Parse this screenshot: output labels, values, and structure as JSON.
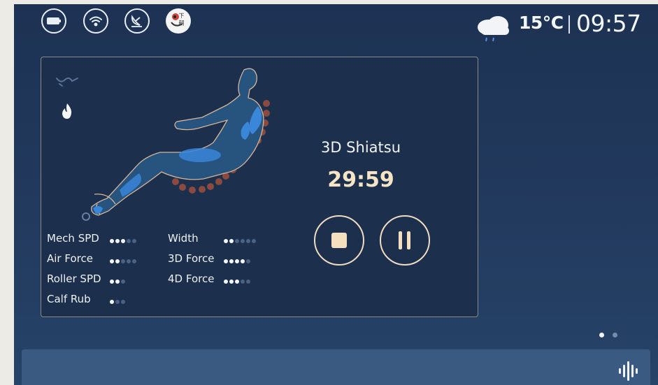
{
  "status_bar": {
    "icons": [
      "battery-icon",
      "wifi-icon",
      "satellite-dish-icon",
      "mascot-badge-icon"
    ],
    "badge_text": "下 朝"
  },
  "weather": {
    "icon": "cloud-rain-icon",
    "temperature": "15°C",
    "time": "09:57"
  },
  "session": {
    "program_name": "3D Shiatsu",
    "remaining_time": "29:59",
    "stop_icon": "stop-icon",
    "pause_icon": "pause-icon"
  },
  "modes": {
    "recline_icon": "zero-gravity-icon",
    "heat_icon": "flame-icon"
  },
  "settings": [
    {
      "label": "Mech SPD",
      "level": 3,
      "max": 5
    },
    {
      "label": "Air Force",
      "level": 2,
      "max": 5
    },
    {
      "label": "Roller SPD",
      "level": 2,
      "max": 3
    },
    {
      "label": "Calf Rub",
      "level": 1,
      "max": 3
    },
    {
      "label": "Width",
      "level": 2,
      "max": 6
    },
    {
      "label": "3D Force",
      "level": 4,
      "max": 5
    },
    {
      "label": "4D Force",
      "level": 3,
      "max": 5
    }
  ],
  "pager": {
    "page": 1,
    "pages": 2
  },
  "voice": {
    "icon": "voice-waveform-icon"
  },
  "colors": {
    "accent": "#f6dfbf",
    "screen_bg": "#1d3253",
    "panel_bg": "#1c2f4d",
    "massage_node": "#8a4a3f",
    "active_node": "#e8623f",
    "body_highlight": "#3a86d9"
  }
}
